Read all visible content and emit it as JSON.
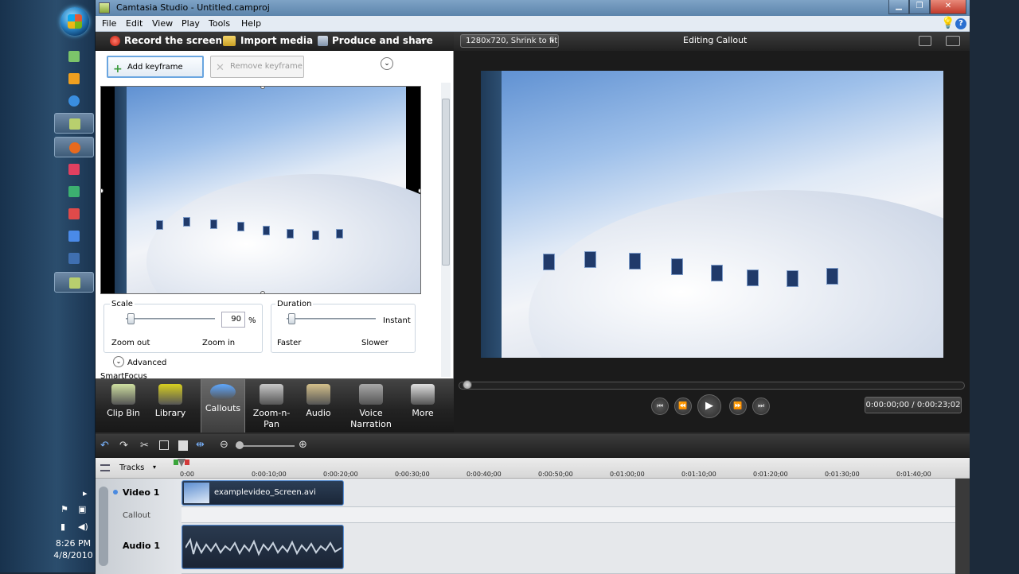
{
  "taskbar": {
    "clock_time": "8:26 PM",
    "clock_date": "4/8/2010"
  },
  "window": {
    "title": "Camtasia Studio - Untitled.camproj",
    "menu": [
      "File",
      "Edit",
      "View",
      "Play",
      "Tools",
      "Help"
    ],
    "toolbar": {
      "record": "Record the screen",
      "import": "Import media",
      "produce": "Produce and share"
    }
  },
  "taskpane": {
    "add_keyframe": "Add keyframe",
    "remove_keyframe": "Remove keyframe",
    "scale": {
      "label": "Scale",
      "value": "90",
      "unit": "%",
      "left": "Zoom out",
      "right": "Zoom in",
      "level": 0.02
    },
    "duration": {
      "label": "Duration",
      "right_label": "Instant",
      "left": "Faster",
      "right": "Slower",
      "level": 0.02
    },
    "advanced": "Advanced",
    "smartfocus": "SmartFocus"
  },
  "tools": [
    {
      "label": "Clip Bin",
      "icon": "clip-bin-icon"
    },
    {
      "label": "Library",
      "icon": "library-icon"
    },
    {
      "label": "Callouts",
      "icon": "callouts-icon",
      "active": true
    },
    {
      "label": "Zoom-n-\nPan",
      "icon": "zoom-n-pan-icon"
    },
    {
      "label": "Audio",
      "icon": "audio-icon"
    },
    {
      "label": "Voice\nNarration",
      "icon": "voice-narration-icon"
    },
    {
      "label": "More",
      "icon": "more-icon"
    }
  ],
  "preview": {
    "size_option": "1280x720, Shrink to fit",
    "heading": "Editing Callout",
    "time": "0:00:00;00 / 0:00:23;02"
  },
  "timeline": {
    "tracks_label": "Tracks",
    "ticks": [
      "0:00",
      "0:00:10;00",
      "0:00:20;00",
      "0:00:30;00",
      "0:00:40;00",
      "0:00:50;00",
      "0:01:00;00",
      "0:01:10;00",
      "0:01:20;00",
      "0:01:30;00",
      "0:01:40;00"
    ],
    "video_track": "Video 1",
    "callout_track": "Callout",
    "audio_track": "Audio 1",
    "video_clip": "examplevideo_Screen.avi"
  }
}
